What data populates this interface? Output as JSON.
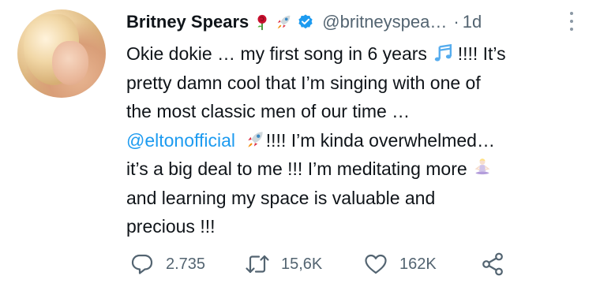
{
  "tweet": {
    "author_name": "Britney Spears",
    "handle": "@britneyspea…",
    "separator": "·",
    "time": "1d",
    "author_emojis": [
      "rose-icon",
      "rocket-icon"
    ],
    "lines": [
      {
        "parts": [
          {
            "text": "Okie dokie … my first song in 6 years "
          },
          {
            "icon": "music-notes-icon"
          },
          {
            "text": " !!!! It’s"
          }
        ]
      },
      {
        "parts": [
          {
            "text": "pretty damn cool that I’m singing with one of"
          }
        ]
      },
      {
        "parts": [
          {
            "text": "the most classic men of our time …"
          }
        ]
      },
      {
        "parts": [
          {
            "text": "@eltonofficial",
            "mention": true
          },
          {
            "text": "  "
          },
          {
            "icon": "rocket-icon"
          },
          {
            "text": "!!!! I’m kinda overwhelmed…"
          }
        ]
      },
      {
        "parts": [
          {
            "text": "it’s a big deal to me !!! I’m meditating more "
          },
          {
            "icon": "meditating-person-icon"
          }
        ]
      },
      {
        "parts": [
          {
            "text": "and learning my space is valuable and"
          }
        ]
      },
      {
        "parts": [
          {
            "text": "precious !!!"
          }
        ]
      }
    ]
  },
  "actions": {
    "reply_count": "2.735",
    "retweet_count": "15,6K",
    "like_count": "162K"
  },
  "colors": {
    "text": "#0f1419",
    "secondary": "#536471",
    "accent": "#1d9bf0"
  }
}
